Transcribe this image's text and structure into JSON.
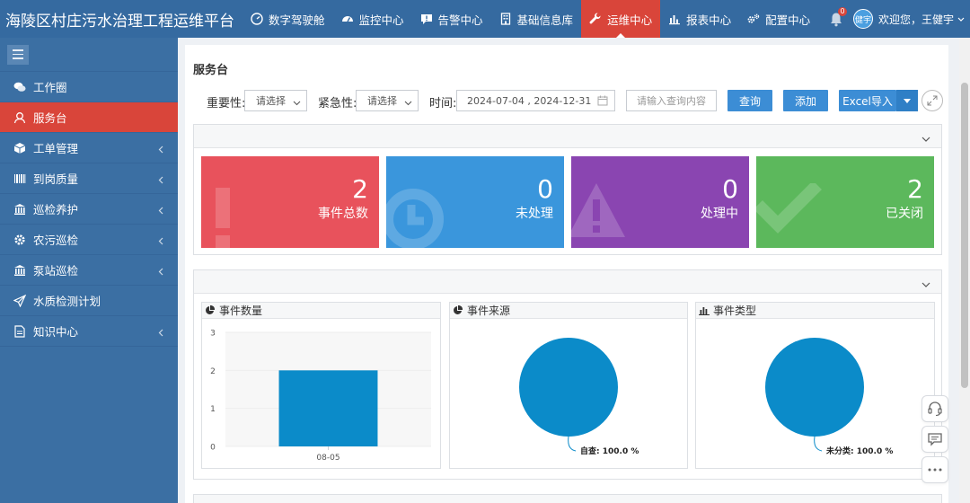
{
  "app": {
    "title": "海陵区村庄污水治理工程运维平台"
  },
  "topnav": [
    {
      "label": "数字驾驶舱",
      "icon": "dashboard-icon"
    },
    {
      "label": "监控中心",
      "icon": "speedometer-icon"
    },
    {
      "label": "告警中心",
      "icon": "alert-message-icon"
    },
    {
      "label": "基础信息库",
      "icon": "building-icon"
    },
    {
      "label": "运维中心",
      "icon": "wrench-icon",
      "active": true
    },
    {
      "label": "报表中心",
      "icon": "bar-chart-icon"
    },
    {
      "label": "配置中心",
      "icon": "gears-icon"
    }
  ],
  "user": {
    "notification_count": "0",
    "avatar_text": "健宇",
    "welcome": "欢迎您，王健宇"
  },
  "sidebar": {
    "items": [
      {
        "label": "工作圈",
        "icon": "chat-icon"
      },
      {
        "label": "服务台",
        "icon": "user-headset-icon",
        "active": true
      },
      {
        "label": "工单管理",
        "icon": "box-icon",
        "has_children": true
      },
      {
        "label": "到岗质量",
        "icon": "barcode-icon",
        "has_children": true
      },
      {
        "label": "巡检养护",
        "icon": "bank-icon",
        "has_children": true
      },
      {
        "label": "农污巡检",
        "icon": "gear-icon",
        "has_children": true
      },
      {
        "label": "泵站巡检",
        "icon": "bank-icon",
        "has_children": true
      },
      {
        "label": "水质检测计划",
        "icon": "send-icon"
      },
      {
        "label": "知识中心",
        "icon": "document-icon",
        "has_children": true
      }
    ]
  },
  "page": {
    "title": "服务台"
  },
  "filters": {
    "importance_label": "重要性:",
    "importance_value": "请选择",
    "urgency_label": "紧急性:",
    "urgency_value": "请选择",
    "time_label": "时间:",
    "time_value": "2024-07-04 , 2024-12-31",
    "search_placeholder": "请输入查询内容",
    "query_button": "查询",
    "add_button": "添加",
    "import_button": "Excel导入"
  },
  "stats": [
    {
      "value": "2",
      "label": "事件总数",
      "color": "#e8525c"
    },
    {
      "value": "0",
      "label": "未处理",
      "color": "#3a96dc"
    },
    {
      "value": "0",
      "label": "处理中",
      "color": "#8a45b1"
    },
    {
      "value": "2",
      "label": "已关闭",
      "color": "#5cb85c"
    }
  ],
  "charts": {
    "count": {
      "title": "事件数量"
    },
    "source": {
      "title": "事件来源"
    },
    "type": {
      "title": "事件类型"
    }
  },
  "chart_data": [
    {
      "type": "bar",
      "title": "事件数量",
      "categories": [
        "08-05"
      ],
      "values": [
        2
      ],
      "ylim": [
        0,
        3
      ],
      "yticks": [
        0,
        1,
        2,
        3
      ],
      "color": "#0b8bc9"
    },
    {
      "type": "pie",
      "title": "事件来源",
      "slices": [
        {
          "label": "自查",
          "percent": "100.0 %",
          "value": 100
        }
      ],
      "color": "#0b8bc9"
    },
    {
      "type": "pie",
      "title": "事件类型",
      "slices": [
        {
          "label": "未分类",
          "percent": "100.0 %",
          "value": 100
        }
      ],
      "color": "#0b8bc9"
    }
  ]
}
